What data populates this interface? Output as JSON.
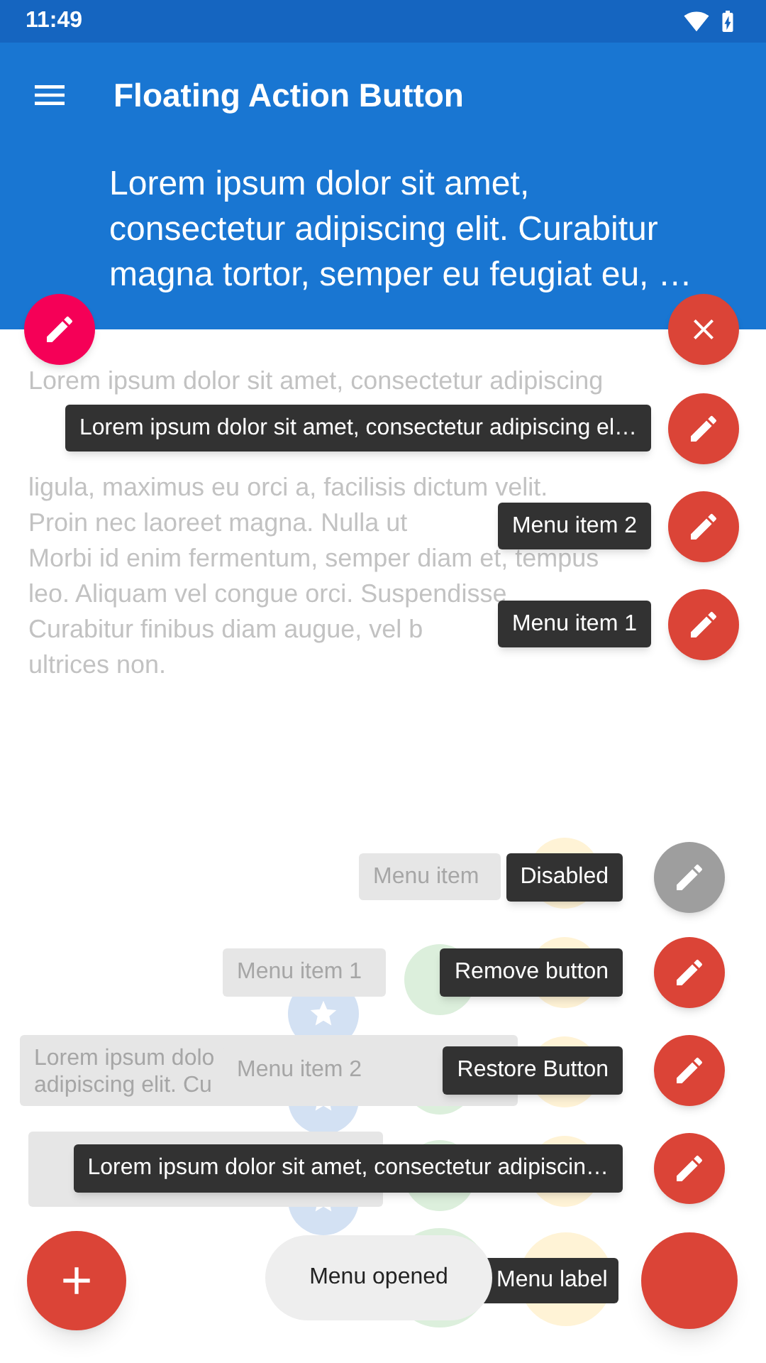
{
  "status_bar": {
    "time": "11:49"
  },
  "app_bar": {
    "title": "Floating Action Button",
    "header_lines": [
      "Lorem ipsum dolor sit amet,",
      "consectetur adipiscing elit. Curabitur",
      "magna tortor, semper eu feugiat eu, …"
    ]
  },
  "body_lines": [
    "Lorem ipsum dolor sit amet, consectetur adipiscing",
    "ligula, maximus eu orci a, facilisis dictum velit.",
    "Proin nec laoreet magna. Nulla ut",
    "Morbi id enim fermentum, semper diam et, tempus",
    "leo. Aliquam vel congue orci. Suspendisse",
    "Curabitur finibus diam augue, vel b",
    "ultrices non."
  ],
  "top_menu": {
    "items": [
      {
        "label": "Lorem ipsum dolor sit amet, consectetur adipiscing el…"
      },
      {
        "label": "Menu item 2"
      },
      {
        "label": "Menu item 1"
      }
    ]
  },
  "faded_labels": [
    {
      "lines": [
        "Menu item"
      ]
    },
    {
      "lines": [
        "Menu item 1"
      ]
    },
    {
      "lines": [
        "Lorem ipsum dolo",
        "adipiscing elit. Cu"
      ]
    },
    {
      "lines": [
        "Menu item 2"
      ]
    }
  ],
  "bottom_menu": {
    "items": [
      {
        "label": "Disabled",
        "disabled": true
      },
      {
        "label": "Remove button",
        "disabled": false
      },
      {
        "label": "Restore Button",
        "disabled": false
      },
      {
        "label": "Lorem ipsum dolor sit amet, consectetur adipiscin…",
        "disabled": false
      }
    ],
    "main_label": "Menu label"
  },
  "toast": "Menu opened"
}
